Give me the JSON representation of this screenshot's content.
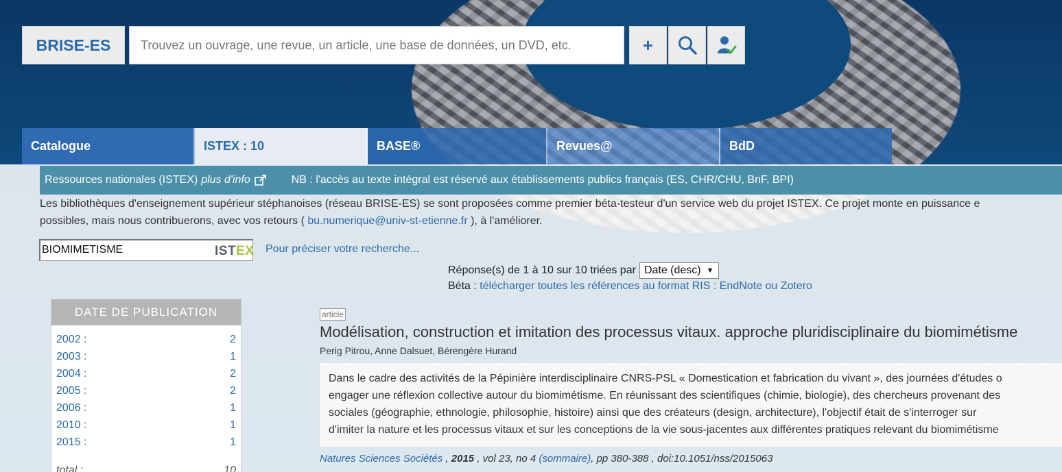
{
  "header": {
    "brand": "BRISE-ES",
    "search_placeholder": "Trouvez un ouvrage, une revue, un article, une base de données, un DVD, etc.",
    "plus_label": "+",
    "icons": {
      "search": "search-icon",
      "user": "user-check-icon"
    }
  },
  "tabs": [
    {
      "label": "Catalogue"
    },
    {
      "label": "ISTEX : 10"
    },
    {
      "label": "BASE®"
    },
    {
      "label": "Revues@"
    },
    {
      "label": "BdD"
    }
  ],
  "infobar": {
    "title": "Ressources nationales (ISTEX)",
    "more_info": "plus d'info",
    "nb": "NB : l'accès au texte intégral est réservé aux établissements publics français (ES, CHR/CHU, BnF, BPI)"
  },
  "intro": {
    "line1": "Les bibliothèques d'enseignement supérieur stéphanoises (réseau BRISE-ES) se sont proposées comme premier béta-testeur d'un service web du projet ISTEX. Ce projet monte en puissance e",
    "line2_before": "possibles, mais nous contribuerons, avec vos retours ( ",
    "email": "bu.numerique@univ-st-etienne.fr",
    "line2_after": " ), à l'améliorer."
  },
  "istex_search": {
    "value": "BIOMIMETISME",
    "logo_a": "IST",
    "logo_b": "EX",
    "refine": "Pour préciser votre recherche..."
  },
  "results": {
    "summary": "Réponse(s) de 1 à 10 sur 10 triées par",
    "sort_selected": "Date (desc)",
    "beta_prefix": "Béta : ",
    "beta_link": "télécharger toutes les références au format RIS : EndNote ou Zotero"
  },
  "facet": {
    "title": "DATE DE PUBLICATION",
    "rows": [
      {
        "year": "2002 :",
        "count": "2"
      },
      {
        "year": "2003 :",
        "count": "1"
      },
      {
        "year": "2004 :",
        "count": "2"
      },
      {
        "year": "2005 :",
        "count": "2"
      },
      {
        "year": "2006 :",
        "count": "1"
      },
      {
        "year": "2010 :",
        "count": "1"
      },
      {
        "year": "2015 :",
        "count": "1"
      }
    ],
    "total_label": "total :",
    "total_count": "10"
  },
  "item": {
    "badge": "article",
    "title": "Modélisation, construction et imitation des processus vitaux. approche pluridisciplinaire du biomimétisme",
    "authors": "Perig Pitrou, Anne Dalsuet, Bérengère Hurand",
    "abstract": [
      "Dans le cadre des activités de la Pépinière interdisciplinaire CNRS-PSL « Domestication et fabrication du vivant », des journées d'études o",
      "engager une réflexion collective autour du biomimétisme. En réunissant des scientifiques (chimie, biologie), des chercheurs provenant des",
      "sociales (géographie, ethnologie, philosophie, histoire) ainsi que des créateurs (design, architecture), l'objectif était de s'interroger sur",
      "d'imiter la nature et les processus vitaux et sur les conceptions de la vie sous-jacentes aux différentes pratiques relevant du biomimétisme"
    ],
    "journal": "Natures Sciences Sociétés",
    "year": "2015",
    "volume": " , vol 23, no 4 ",
    "sommaire": "(sommaire)",
    "pages_doi": ", pp 380-388 , doi:10.1051/nss/2015063"
  }
}
